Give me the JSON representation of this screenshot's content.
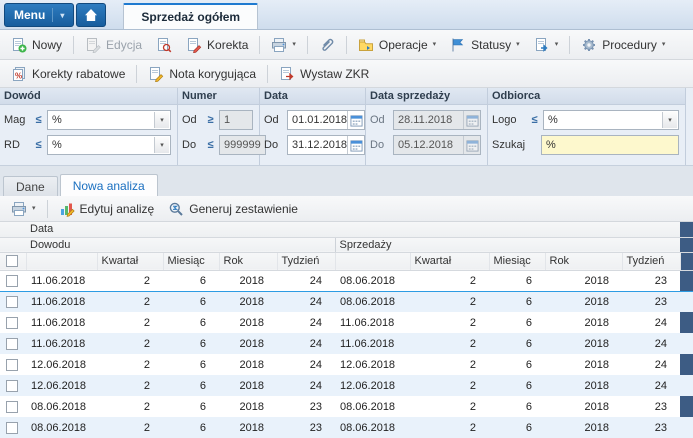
{
  "topbar": {
    "menu_label": "Menu",
    "document_tab": "Sprzedaż ogółem"
  },
  "toolbar_main": {
    "new": "Nowy",
    "edit": "Edycja",
    "correction": "Korekta",
    "operations": "Operacje",
    "statuses": "Statusy",
    "procedures": "Procedury"
  },
  "toolbar_corrections": {
    "discount_corrections": "Korekty rabatowe",
    "correcting_note": "Nota korygująca",
    "issue_zkr": "Wystaw ZKR"
  },
  "filters": {
    "sections": {
      "document": "Dowód",
      "number": "Numer",
      "date": "Data",
      "sale_date": "Data sprzedaży",
      "recipient": "Odbiorca"
    },
    "document": {
      "mag_label": "Mag",
      "mag_op": "≤",
      "mag_value": "%",
      "rd_label": "RD",
      "rd_op": "≤",
      "rd_value": "%"
    },
    "number": {
      "from_label": "Od",
      "from_op": "≥",
      "from_value": "1",
      "to_label": "Do",
      "to_op": "≤",
      "to_value": "999999"
    },
    "date": {
      "from_label": "Od",
      "from_value": "01.01.2018",
      "to_label": "Do",
      "to_value": "31.12.2018"
    },
    "sale_date": {
      "from_label": "Od",
      "from_value": "28.11.2018",
      "to_label": "Do",
      "to_value": "05.12.2018"
    },
    "recipient": {
      "logo_label": "Logo",
      "logo_op": "≤",
      "logo_value": "%",
      "search_label": "Szukaj",
      "search_value": "%"
    }
  },
  "view_tabs": {
    "data": "Dane",
    "new_analysis": "Nowa analiza"
  },
  "analysis_toolbar": {
    "edit_analysis": "Edytuj analizę",
    "generate_report": "Generuj zestawienie"
  },
  "grid": {
    "group_header": "Data",
    "subgroup_document": "Dowodu",
    "subgroup_sale": "Sprzedaży",
    "columns": [
      "Kwartał",
      "Miesiąc",
      "Rok",
      "Tydzień"
    ],
    "rows": [
      [
        "11.06.2018",
        "2",
        "6",
        "2018",
        "24",
        "08.06.2018",
        "2",
        "6",
        "2018",
        "23"
      ],
      [
        "11.06.2018",
        "2",
        "6",
        "2018",
        "24",
        "08.06.2018",
        "2",
        "6",
        "2018",
        "23"
      ],
      [
        "11.06.2018",
        "2",
        "6",
        "2018",
        "24",
        "11.06.2018",
        "2",
        "6",
        "2018",
        "24"
      ],
      [
        "11.06.2018",
        "2",
        "6",
        "2018",
        "24",
        "11.06.2018",
        "2",
        "6",
        "2018",
        "24"
      ],
      [
        "12.06.2018",
        "2",
        "6",
        "2018",
        "24",
        "12.06.2018",
        "2",
        "6",
        "2018",
        "24"
      ],
      [
        "12.06.2018",
        "2",
        "6",
        "2018",
        "24",
        "12.06.2018",
        "2",
        "6",
        "2018",
        "24"
      ],
      [
        "08.06.2018",
        "2",
        "6",
        "2018",
        "23",
        "08.06.2018",
        "2",
        "6",
        "2018",
        "23"
      ],
      [
        "08.06.2018",
        "2",
        "6",
        "2018",
        "23",
        "08.06.2018",
        "2",
        "6",
        "2018",
        "23"
      ]
    ]
  }
}
